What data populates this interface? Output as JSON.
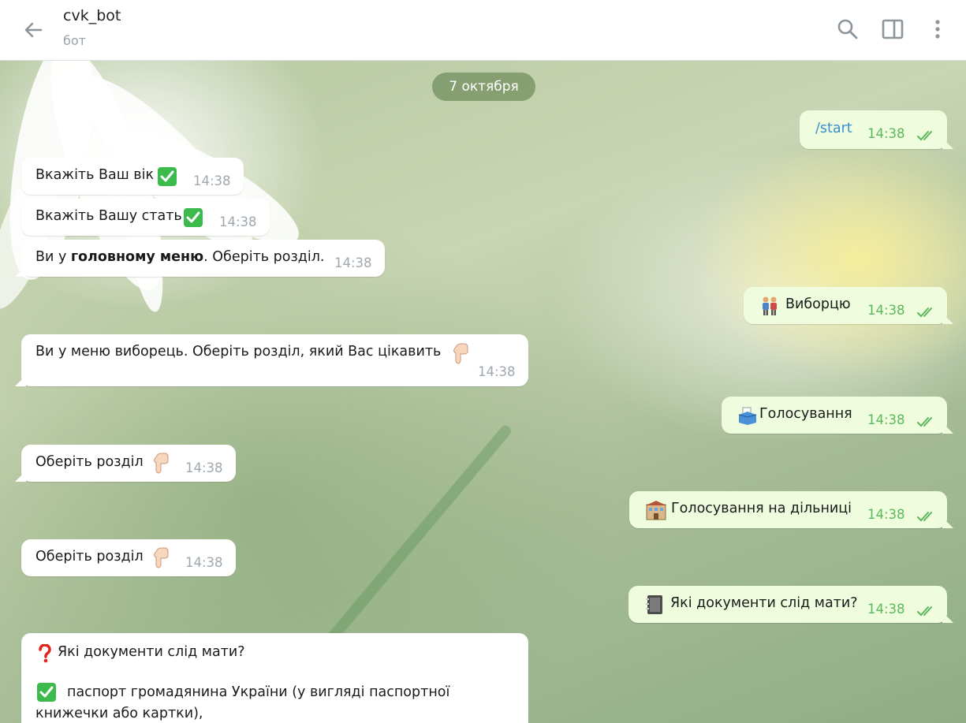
{
  "header": {
    "title": "cvk_bot",
    "subtitle": "бот"
  },
  "chat": {
    "date": "7 октября",
    "messages": [
      {
        "dir": "out",
        "text": "/start",
        "time": "14:38"
      },
      {
        "dir": "in",
        "text": "Вкажіть Ваш вік",
        "time": "14:38"
      },
      {
        "dir": "in",
        "text": "Вкажіть Вашу стать",
        "time": "14:38"
      },
      {
        "dir": "in",
        "text_before": "Ви у ",
        "text_bold": "головному меню",
        "text_after": ". Оберіть розділ.",
        "time": "14:38"
      },
      {
        "dir": "out",
        "text": "Виборцю",
        "time": "14:38"
      },
      {
        "dir": "in",
        "text": "Ви у меню виборець. Оберіть розділ, який Вас цікавить",
        "time": "14:38"
      },
      {
        "dir": "out",
        "text": "Голосування",
        "time": "14:38"
      },
      {
        "dir": "in",
        "text": "Оберіть розділ",
        "time": "14:38"
      },
      {
        "dir": "out",
        "text": "Голосування на дільниці",
        "time": "14:38"
      },
      {
        "dir": "in",
        "text": "Оберіть розділ",
        "time": "14:38"
      },
      {
        "dir": "out",
        "text": "Які документи слід мати?",
        "time": "14:38"
      },
      {
        "dir": "in",
        "line1": "Які документи слід мати?",
        "line2": "паспорт громадянина України (у вигляді паспортної",
        "line3": "книжечки або картки),"
      }
    ]
  },
  "colors": {
    "outgoing_bubble": "#effdde",
    "incoming_bubble": "#ffffff",
    "read_ticks": "#5cb85c",
    "link": "#3a8fcf"
  },
  "icons": [
    "back-arrow-icon",
    "search-icon",
    "sidebar-toggle-icon",
    "more-vertical-icon",
    "check-mark-emoji",
    "pointing-down-emoji",
    "people-emoji",
    "ballot-box-emoji",
    "building-emoji",
    "notebook-emoji",
    "question-mark-emoji",
    "double-check-icon"
  ]
}
